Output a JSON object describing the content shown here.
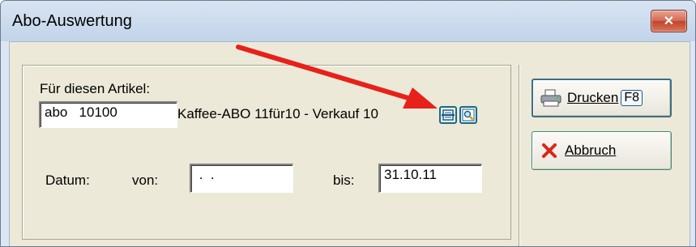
{
  "window": {
    "title": "Abo-Auswertung",
    "close_label": "✕"
  },
  "form": {
    "article_label": "Für diesen Artikel:",
    "article_value": "abo   10100",
    "article_description": "Kaffee-ABO 11für10 - Verkauf 10",
    "date_label": "Datum:",
    "from_label": "von:",
    "from_value": " .  .",
    "to_label": "bis:",
    "to_value": "31.10.11"
  },
  "buttons": {
    "print_label": "Drucken",
    "print_shortcut": "F8",
    "cancel_label": "Abbruch"
  },
  "colors": {
    "annotation_arrow": "#e8201a",
    "window_frame": "#dbe6f2",
    "client_background": "#ece9d8"
  },
  "icons": {
    "article_list": "list-icon",
    "article_search": "magnifier-icon",
    "print": "printer-icon",
    "cancel": "red-x-icon"
  }
}
